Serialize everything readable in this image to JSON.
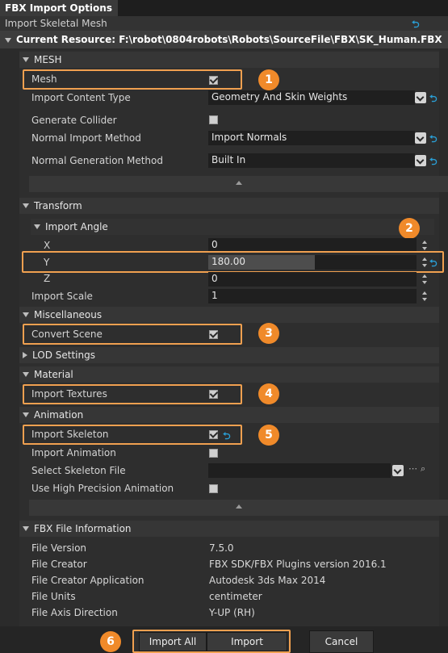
{
  "window": {
    "tab_title": "FBX Import Options",
    "subtitle": "Import Skeletal Mesh",
    "current_resource": "Current Resource: F:\\robot\\0804robots\\Robots\\SourceFile\\FBX\\SK_Human.FBX"
  },
  "mesh": {
    "header": "MESH",
    "mesh_label": "Mesh",
    "mesh_checked": true,
    "import_content_type_label": "Import Content Type",
    "import_content_type_value": "Geometry And Skin Weights",
    "generate_collider_label": "Generate Collider",
    "generate_collider_checked": false,
    "normal_import_method_label": "Normal Import Method",
    "normal_import_method_value": "Import Normals",
    "normal_generation_method_label": "Normal Generation Method",
    "normal_generation_method_value": "Built In"
  },
  "transform": {
    "header": "Transform",
    "import_angle_header": "Import Angle",
    "x_label": "X",
    "x_value": "0",
    "y_label": "Y",
    "y_value": "180.00",
    "z_label": "Z",
    "z_value": "0",
    "import_scale_label": "Import Scale",
    "import_scale_value": "1"
  },
  "misc": {
    "header": "Miscellaneous",
    "convert_scene_label": "Convert Scene",
    "convert_scene_checked": true,
    "lod_settings_label": "LOD Settings"
  },
  "material": {
    "header": "Material",
    "import_textures_label": "Import Textures",
    "import_textures_checked": true
  },
  "animation": {
    "header": "Animation",
    "import_skeleton_label": "Import Skeleton",
    "import_skeleton_checked": true,
    "import_animation_label": "Import Animation",
    "import_animation_checked": false,
    "select_skeleton_file_label": "Select Skeleton File",
    "select_skeleton_file_value": "",
    "high_precision_label": "Use High Precision Animation",
    "high_precision_checked": false
  },
  "fbx_info": {
    "header": "FBX File Information",
    "rows": [
      {
        "label": "File Version",
        "value": "7.5.0"
      },
      {
        "label": "File Creator",
        "value": "FBX SDK/FBX Plugins version 2016.1"
      },
      {
        "label": "File Creator Application",
        "value": "Autodesk 3ds Max 2014"
      },
      {
        "label": "File Units",
        "value": "centimeter"
      },
      {
        "label": "File Axis Direction",
        "value": "Y-UP (RH)"
      }
    ]
  },
  "buttons": {
    "import_all": "Import All",
    "import": "Import",
    "cancel": "Cancel"
  },
  "badges": [
    "1",
    "2",
    "3",
    "4",
    "5",
    "6"
  ],
  "colors": {
    "highlight": "#f0a050",
    "badge": "#f08a2a",
    "reset_icon": "#2a9fd6"
  }
}
